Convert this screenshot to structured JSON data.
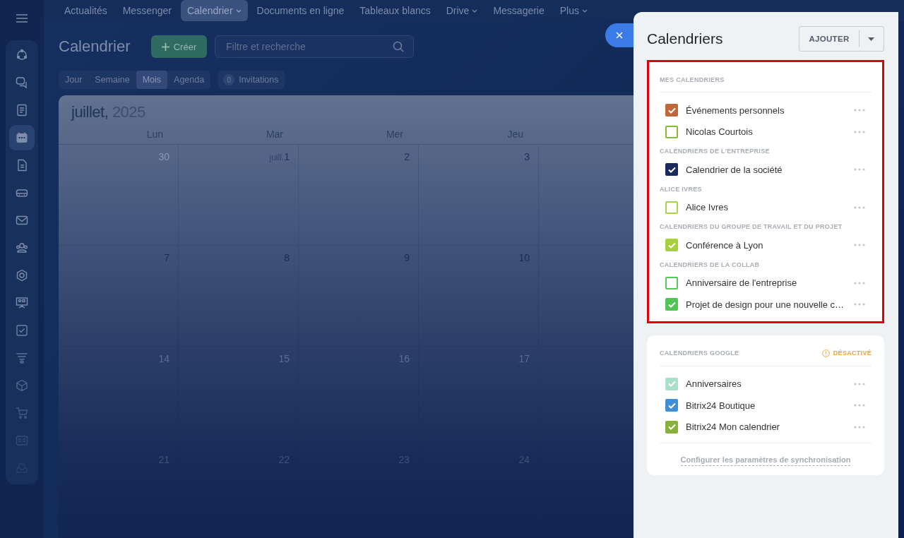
{
  "top_nav": [
    {
      "label": "Actualités",
      "selected": false,
      "has_menu": false
    },
    {
      "label": "Messenger",
      "selected": false,
      "has_menu": false
    },
    {
      "label": "Calendrier",
      "selected": true,
      "has_menu": true
    },
    {
      "label": "Documents en ligne",
      "selected": false,
      "has_menu": false
    },
    {
      "label": "Tableaux blancs",
      "selected": false,
      "has_menu": false
    },
    {
      "label": "Drive",
      "selected": false,
      "has_menu": true
    },
    {
      "label": "Messagerie",
      "selected": false,
      "has_menu": false
    },
    {
      "label": "Plus",
      "selected": false,
      "has_menu": true
    }
  ],
  "page": {
    "title": "Calendrier",
    "create_button": "Créer",
    "search": {
      "placeholder": "Filtre et recherche"
    },
    "views": [
      {
        "label": "Jour",
        "selected": false
      },
      {
        "label": "Semaine",
        "selected": false
      },
      {
        "label": "Mois",
        "selected": true
      },
      {
        "label": "Agenda",
        "selected": false
      }
    ],
    "invitations": {
      "count": "0",
      "label": "Invitations"
    }
  },
  "calendar": {
    "month": "juillet,",
    "year": "2025",
    "weekdays": [
      "Lun",
      "Mar",
      "Mer",
      "Jeu"
    ],
    "weeks": [
      [
        {
          "day": "30",
          "muted": true
        },
        {
          "day": "1",
          "month_label": "juill.",
          "muted": false
        },
        {
          "day": "2",
          "muted": false
        },
        {
          "day": "3",
          "muted": false
        }
      ],
      [
        {
          "day": "7",
          "muted": false
        },
        {
          "day": "8",
          "muted": false
        },
        {
          "day": "9",
          "muted": false
        },
        {
          "day": "10",
          "muted": false
        }
      ],
      [
        {
          "day": "14",
          "muted": false
        },
        {
          "day": "15",
          "muted": false
        },
        {
          "day": "16",
          "muted": false
        },
        {
          "day": "17",
          "muted": false
        }
      ],
      [
        {
          "day": "21",
          "muted": false
        },
        {
          "day": "22",
          "muted": false
        },
        {
          "day": "23",
          "muted": false
        },
        {
          "day": "24",
          "muted": false
        }
      ]
    ]
  },
  "panel": {
    "title": "Calendriers",
    "add_button": "AJOUTER",
    "highlighted": true,
    "groups": [
      {
        "heading": "MES CALENDRIERS",
        "items": [
          {
            "name": "Événements personnels",
            "checked": true,
            "color": "#c0683a"
          },
          {
            "name": "Nicolas Courtois",
            "checked": false,
            "color": "#8ab83a"
          }
        ]
      },
      {
        "heading": "CALENDRIERS DE L'ENTREPRISE",
        "items": [
          {
            "name": "Calendrier de la société",
            "checked": true,
            "color": "#1b2a5e"
          }
        ]
      },
      {
        "heading": "ALICE IVRES",
        "items": [
          {
            "name": "Alice Ivres",
            "checked": false,
            "color": "#a8d44a"
          }
        ]
      },
      {
        "heading": "CALENDRIERS DU GROUPE DE TRAVAIL ET DU PROJET",
        "items": [
          {
            "name": "Conférence à Lyon",
            "checked": true,
            "color": "#a6d13c"
          }
        ]
      },
      {
        "heading": "CALENDRIERS DE LA COLLAB",
        "items": [
          {
            "name": "Anniversaire de l'entreprise",
            "checked": false,
            "color": "#5cc85a"
          },
          {
            "name": "Projet de design pour une nouvelle c…",
            "checked": true,
            "color": "#4fc553"
          }
        ]
      }
    ],
    "google": {
      "heading": "CALENDRIERS GOOGLE",
      "status": "DÉSACTIVÉ",
      "items": [
        {
          "name": "Anniversaires",
          "checked": true,
          "color": "#a8e0c8"
        },
        {
          "name": "Bitrix24 Boutique",
          "checked": true,
          "color": "#3e8fd6"
        },
        {
          "name": "Bitrix24 Mon calendrier",
          "checked": true,
          "color": "#86b13a"
        }
      ],
      "link": "Configurer les paramètres de synchronisation"
    }
  }
}
